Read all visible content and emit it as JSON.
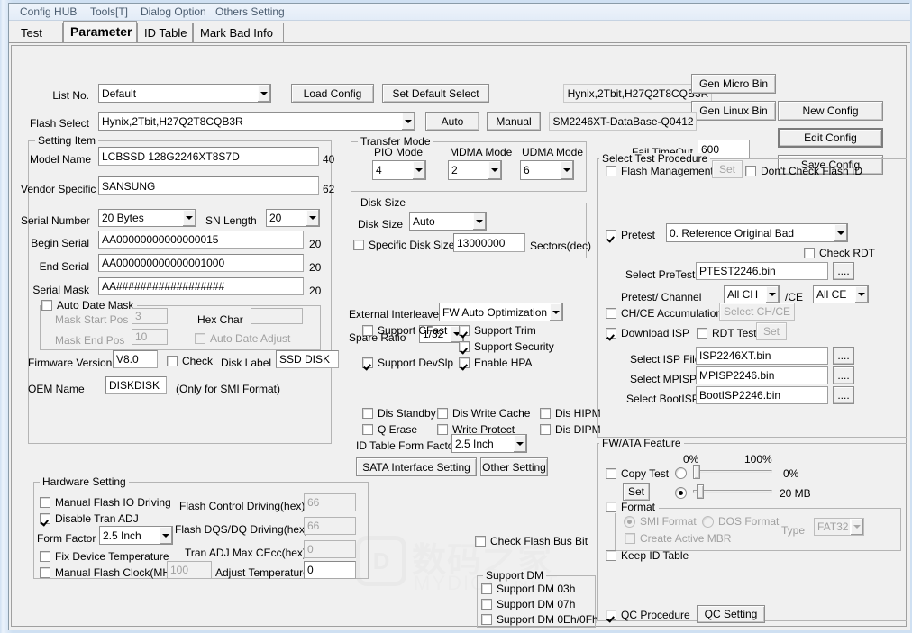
{
  "window": {
    "title": ""
  },
  "menubar": {
    "items": [
      {
        "label": "Config HUB"
      },
      {
        "label": "Tools[T]"
      },
      {
        "label": "Dialog Option"
      },
      {
        "label": "Others Setting"
      }
    ]
  },
  "tabs": [
    {
      "label": "Test",
      "selected": false
    },
    {
      "label": "Parameter",
      "selected": true
    },
    {
      "label": "ID Table",
      "selected": false
    },
    {
      "label": "Mark Bad Info",
      "selected": false
    }
  ],
  "top": {
    "list_no_label": "List No.",
    "list_no_value": "Default",
    "flash_select_label": "Flash Select",
    "flash_select_value": "Hynix,2Tbit,H27Q2T8CQB3R",
    "load_config": "Load Config",
    "set_default_select": "Set Default Select",
    "auto": "Auto",
    "manual": "Manual",
    "flash_info_readonly": "Hynix,2Tbit,H27Q2T8CQB3R",
    "database_readonly": "SM2246XT-DataBase-Q0412",
    "gen_micro_bin": "Gen Micro Bin",
    "gen_linux_bin": "Gen Linux Bin",
    "new_config": "New Config",
    "edit_config": "Edit Config",
    "save_config": "Save Config",
    "fail_timeout_label": "Fail TimeOut",
    "fail_timeout_value": "600"
  },
  "setting_item": {
    "caption": "Setting Item",
    "model_name_label": "Model Name",
    "model_name_value": "LCBSSD 128G2246XT8S7D",
    "model_name_len": "40",
    "vendor_specific_label": "Vendor Specific",
    "vendor_specific_value": "SANSUNG",
    "vendor_specific_len": "62",
    "serial_number_label": "Serial Number",
    "serial_number_value": "20 Bytes",
    "sn_length_label": "SN Length",
    "sn_length_value": "20",
    "begin_serial_label": "Begin Serial",
    "begin_serial_value": "AA00000000000000015",
    "begin_serial_len": "20",
    "end_serial_label": "End Serial",
    "end_serial_value": "AA000000000000001000",
    "end_serial_len": "20",
    "serial_mask_label": "Serial Mask",
    "serial_mask_value": "AA##################",
    "serial_mask_len": "20",
    "auto_date_mask_label": "Auto Date Mask",
    "auto_date_mask_checked": false,
    "mask_start_pos_label": "Mask Start Pos",
    "mask_start_pos_value": "3",
    "mask_end_pos_label": "Mask End Pos",
    "mask_end_pos_value": "10",
    "hex_char_label": "Hex Char",
    "hex_char_value": "",
    "auto_date_adjust_label": "Auto Date Adjust",
    "auto_date_adjust_checked": false,
    "firmware_version_label": "Firmware Version",
    "firmware_version_value": "V8.0",
    "check_label": "Check",
    "check_checked": false,
    "disk_label_label": "Disk Label",
    "disk_label_value": "SSD DISK",
    "oem_name_label": "OEM Name",
    "oem_name_value": "DISKDISK",
    "oem_note": "(Only for SMI Format)"
  },
  "transfer_mode": {
    "caption": "Transfer Mode",
    "pio_label": "PIO Mode",
    "pio_value": "4",
    "mdma_label": "MDMA Mode",
    "mdma_value": "2",
    "udma_label": "UDMA Mode",
    "udma_value": "6"
  },
  "disk_size": {
    "caption": "Disk Size",
    "disk_size_label": "Disk Size",
    "disk_size_value": "Auto",
    "specific_label": "Specific Disk Size",
    "specific_checked": false,
    "specific_value": "13000000",
    "sectors_label": "Sectors(dec)"
  },
  "middle": {
    "external_interleave_label": "External Interleave",
    "external_interleave_value": "FW Auto Optimization",
    "spare_ratio_label": "Spare Ratio",
    "spare_ratio_value": "1/32",
    "support_cfast": {
      "label": "Support CFast",
      "checked": false
    },
    "support_trim": {
      "label": "Support Trim",
      "checked": true
    },
    "support_security": {
      "label": "Support Security",
      "checked": true
    },
    "support_devslp": {
      "label": "Support DevSlp",
      "checked": true
    },
    "enable_hpa": {
      "label": "Enable HPA",
      "checked": true
    },
    "dis_standby": {
      "label": "Dis Standby",
      "checked": false
    },
    "dis_write_cache": {
      "label": "Dis Write Cache",
      "checked": false
    },
    "dis_hipm": {
      "label": "Dis HIPM",
      "checked": false
    },
    "q_erase": {
      "label": "Q Erase",
      "checked": false
    },
    "write_protect": {
      "label": "Write Protect",
      "checked": false
    },
    "dis_dipm": {
      "label": "Dis DIPM",
      "checked": false
    },
    "id_table_form_factor_label": "ID Table Form Factor",
    "id_table_form_factor_value": "2.5 Inch",
    "sata_interface_setting": "SATA Interface Setting",
    "other_setting": "Other Setting",
    "check_flash_bus_bit": {
      "label": "Check Flash Bus Bit",
      "checked": false
    }
  },
  "support_dm": {
    "caption": "Support DM",
    "items": [
      {
        "label": "Support DM 03h",
        "checked": false
      },
      {
        "label": "Support DM 07h",
        "checked": false
      },
      {
        "label": "Support DM 0Eh/0Fh",
        "checked": false
      }
    ]
  },
  "hardware_setting": {
    "caption": "Hardware Setting",
    "manual_flash_io_driving": {
      "label": "Manual Flash IO Driving",
      "checked": false
    },
    "disable_tran_adj": {
      "label": "Disable Tran ADJ",
      "checked": true
    },
    "form_factor_label": "Form Factor",
    "form_factor_value": "2.5 Inch",
    "fix_device_temperature": {
      "label": "Fix Device Temperature",
      "checked": false
    },
    "manual_flash_clock": {
      "label": "Manual Flash Clock(MHz)",
      "checked": false,
      "value": "100"
    },
    "flash_control_driving_label": "Flash Control Driving(hex)",
    "flash_control_driving_value": "66",
    "flash_dqs_dq_driving_label": "Flash DQS/DQ Driving(hex)",
    "flash_dqs_dq_driving_value": "66",
    "tran_adj_max_cecc_label": "Tran ADJ Max CEcc(hex)",
    "tran_adj_max_cecc_value": "0",
    "adjust_temperature_label": "Adjust Temperature",
    "adjust_temperature_value": "0"
  },
  "test_procedure": {
    "caption": "Select Test Procedure",
    "flash_management": {
      "label": "Flash Management",
      "checked": false
    },
    "set_label": "Set",
    "dont_check_flash_id": {
      "label": "Don't Check Flash ID",
      "checked": false
    },
    "pretest": {
      "label": "Pretest",
      "checked": true,
      "value": "0. Reference Original Bad"
    },
    "check_rdt": {
      "label": "Check RDT",
      "checked": false
    },
    "select_pretest_label": "Select PreTest",
    "select_pretest_value": "PTEST2246.bin",
    "browse_label": "....",
    "pretest_channel_label": "Pretest/ Channel",
    "pretest_channel_value": "All CH",
    "ce_label": "/CE",
    "ce_value": "All CE",
    "chce_accumulation": {
      "label": "CH/CE Accumulation",
      "checked": false
    },
    "select_chce_label": "Select CH/CE",
    "download_isp": {
      "label": "Download ISP",
      "checked": true
    },
    "rdt_test": {
      "label": "RDT Test",
      "checked": false
    },
    "rdt_set_label": "Set",
    "select_isp_file_label": "Select ISP File",
    "select_isp_file_value": "ISP2246XT.bin",
    "select_mpisp_label": "Select MPISP",
    "select_mpisp_value": "MPISP2246.bin",
    "select_bootisp_label": "Select BootISP",
    "select_bootisp_value": "BootISP2246.bin"
  },
  "fw_ata": {
    "caption": "FW/ATA Feature",
    "scale_min": "0%",
    "scale_max": "100%",
    "copy_test": {
      "label": "Copy Test",
      "checked": false
    },
    "set_label": "Set",
    "slider1": {
      "selected": false,
      "value_label": "0%",
      "percent": 0
    },
    "slider2": {
      "selected": true,
      "value_label": "20 MB",
      "percent": 3
    },
    "format": {
      "label": "Format",
      "checked": false
    },
    "smi_format": {
      "label": "SMI Format",
      "selected": true
    },
    "dos_format": {
      "label": "DOS Format",
      "selected": false
    },
    "create_active_mbr": {
      "label": "Create Active MBR",
      "checked": false
    },
    "type_label": "Type",
    "type_value": "FAT32",
    "keep_id_table": {
      "label": "Keep ID Table",
      "checked": false
    },
    "qc_procedure": {
      "label": "QC Procedure",
      "checked": true
    },
    "qc_setting": "QC Setting"
  },
  "watermark": {
    "logo": "D",
    "cn": "数码之家",
    "en": "MYDIGIT.NET"
  },
  "colors": {
    "window_bg": "#f0f0f0",
    "frame": "#cfe0f2",
    "menu_text": "#4b5d70",
    "field_bg": "#ffffff"
  }
}
